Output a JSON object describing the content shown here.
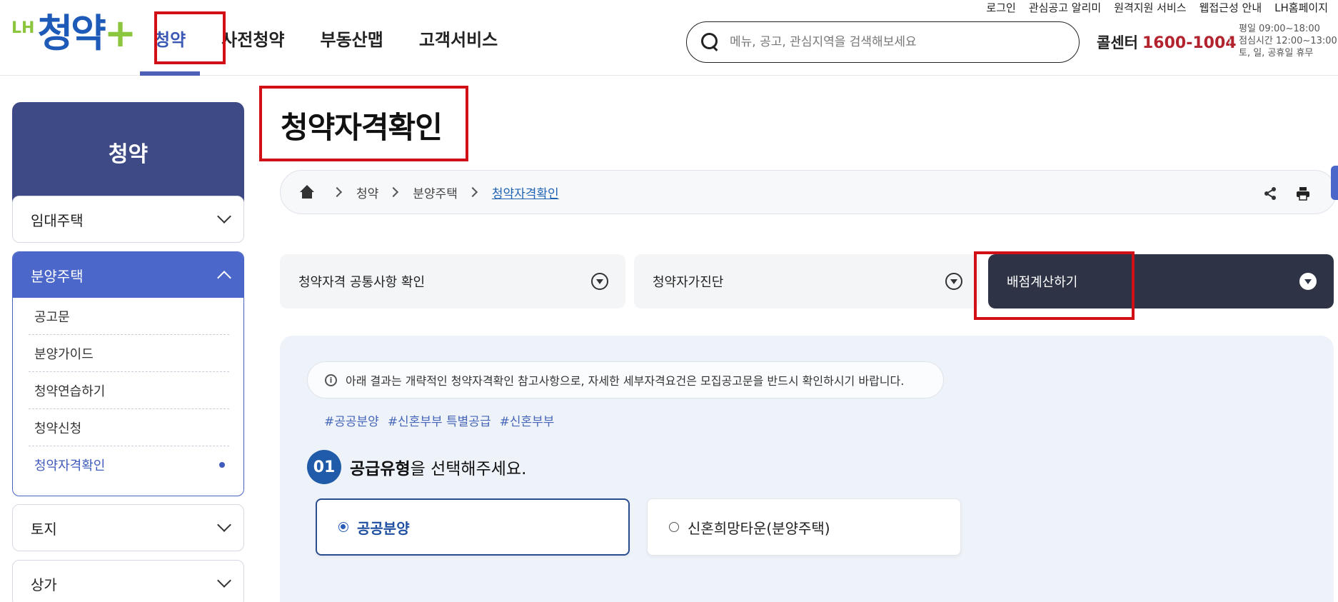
{
  "header": {
    "logo": {
      "prefix": "LH",
      "name": "청약",
      "plus": "+"
    },
    "gnb": [
      {
        "label": "청약",
        "active": true
      },
      {
        "label": "사전청약",
        "active": false
      },
      {
        "label": "부동산맵",
        "active": false
      },
      {
        "label": "고객서비스",
        "active": false
      }
    ],
    "util": [
      "로그인",
      "관심공고 알리미",
      "원격지원 서비스",
      "웹접근성 안내",
      "LH홈페이지"
    ],
    "search": {
      "placeholder": "메뉴, 공고, 관심지역을 검색해보세요"
    },
    "callcenter": {
      "label": "콜센터",
      "number": "1600-1004"
    },
    "hours": [
      "평일 09:00~18:00",
      "점심시간 12:00~13:00",
      "토, 일, 공휴일 휴무"
    ]
  },
  "sidebar": {
    "title": "청약",
    "items": [
      {
        "label": "임대주택"
      },
      {
        "label": "분양주택",
        "open": true,
        "children": [
          "공고문",
          "분양가이드",
          "청약연습하기",
          "청약신청",
          "청약자격확인"
        ]
      },
      {
        "label": "토지"
      },
      {
        "label": "상가"
      }
    ]
  },
  "main": {
    "title": "청약자격확인",
    "breadcrumb": [
      "청약",
      "분양주택",
      "청약자격확인"
    ],
    "tabs": [
      {
        "label": "청약자격 공통사항 확인"
      },
      {
        "label": "청약자가진단"
      },
      {
        "label": "배점계산하기",
        "active": true
      }
    ],
    "notice": "아래 결과는 개략적인 청약자격확인 참고사항으로, 자세한 세부자격요건은 모집공고문을 반드시 확인하시기 바랍니다.",
    "hashtags": [
      "#공공분양",
      "#신혼부부 특별공급",
      "#신혼부부"
    ],
    "step": {
      "num": "01",
      "strong": "공급유형",
      "rest": "을 선택해주세요."
    },
    "options": [
      {
        "label": "공공분양",
        "selected": true
      },
      {
        "label": "신혼희망타운(분양주택)",
        "selected": false
      }
    ]
  },
  "colors": {
    "brand": "#3e4a86",
    "accent": "#4a67c9",
    "highlight": "#d10f17",
    "callcenter": "#b3232e"
  }
}
